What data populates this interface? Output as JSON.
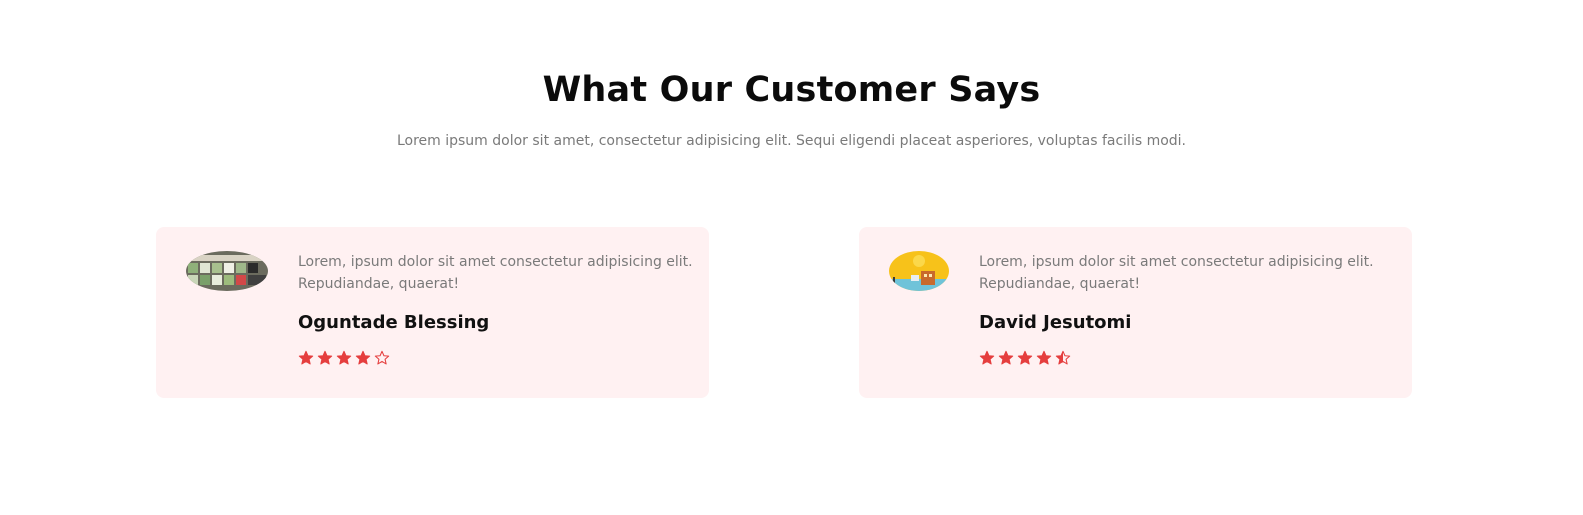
{
  "section": {
    "title": "What Our Customer Says",
    "subtitle": "Lorem ipsum dolor sit amet, consectetur adipisicing elit. Sequi eligendi placeat asperiores, voluptas facilis modi."
  },
  "colors": {
    "card_background": "#fff1f2",
    "star": "#e53e3e",
    "muted_text": "#7a7a7a"
  },
  "testimonials": [
    {
      "quote": "Lorem, ipsum dolor sit amet consectetur adipisicing elit. Repudiandae, quaerat!",
      "name": "Oguntade Blessing",
      "rating": 4,
      "stars": [
        "full",
        "full",
        "full",
        "full",
        "empty"
      ]
    },
    {
      "quote": "Lorem, ipsum dolor sit amet consectetur adipisicing elit. Repudiandae, quaerat!",
      "name": "David Jesutomi",
      "rating": 4.5,
      "stars": [
        "full",
        "full",
        "full",
        "full",
        "half"
      ]
    }
  ]
}
